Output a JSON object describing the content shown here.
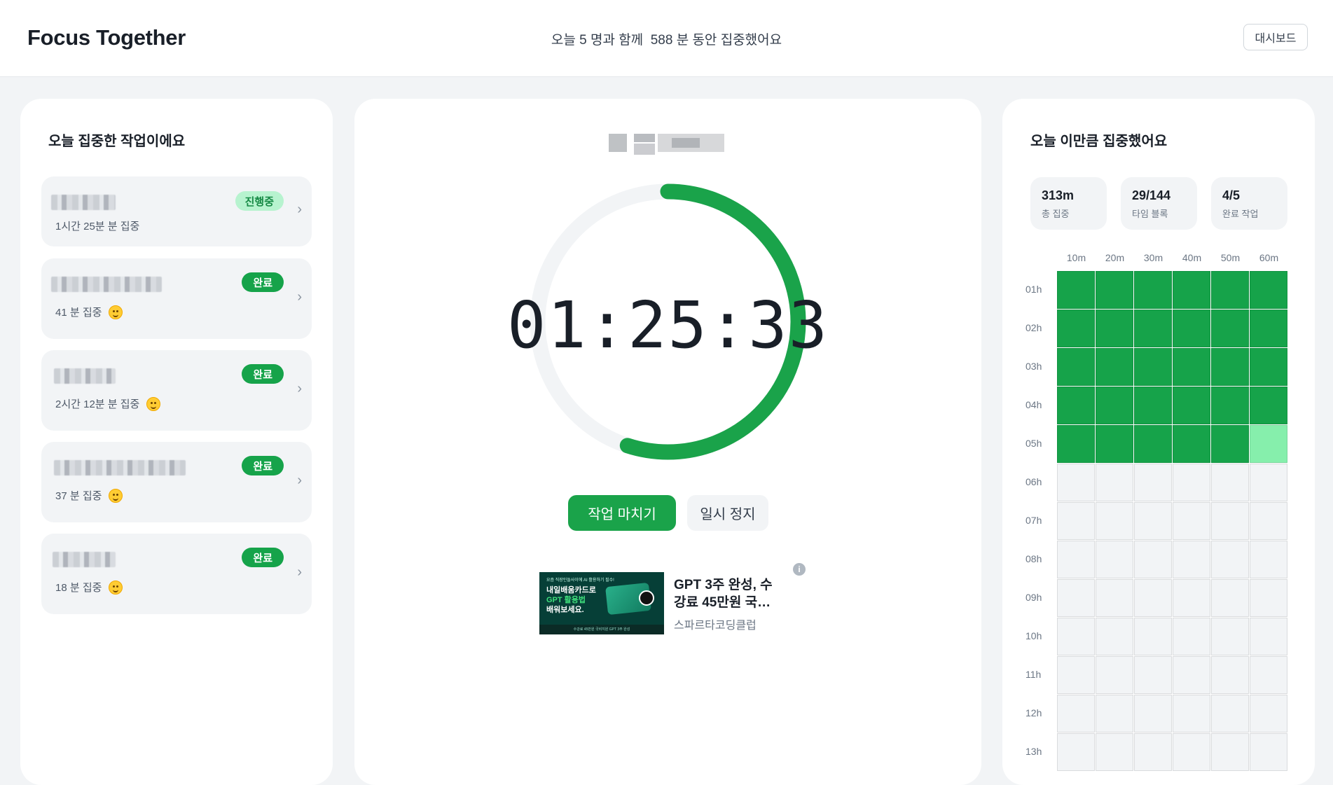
{
  "header": {
    "brand": "Focus Together",
    "summary_parts": [
      "오늘 5 명과 함께  588 분 동안 집중했어요"
    ],
    "dashboard_button": "대시보드"
  },
  "left_panel": {
    "title": "오늘 집중한 작업이에요",
    "tasks": [
      {
        "status": "진행중",
        "status_kind": "progress",
        "duration": "1시간 25분 분 집중",
        "emoji": false
      },
      {
        "status": "완료",
        "status_kind": "done",
        "duration": "41 분 집중",
        "emoji": true
      },
      {
        "status": "완료",
        "status_kind": "done",
        "duration": "2시간 12분 분 집중",
        "emoji": true
      },
      {
        "status": "완료",
        "status_kind": "done",
        "duration": "37 분 집중",
        "emoji": true
      },
      {
        "status": "완료",
        "status_kind": "done",
        "duration": "18 분 집중",
        "emoji": true
      }
    ],
    "chevron_icon": "chevron-right-icon"
  },
  "center_panel": {
    "timer": "01:25:33",
    "progress_fraction": 0.55,
    "colors": {
      "accent": "#1aa34a",
      "track": "#f2f4f6"
    },
    "primary_button": "작업 마치기",
    "secondary_button": "일시 정지",
    "ad": {
      "thumb_small": "요즘 직장인들사이에 AI 활용하기 필수!",
      "thumb_line1": "내일배움카드로",
      "thumb_line2": "GPT 활용법",
      "thumb_line3": "배워보세요.",
      "thumb_bottom": "수강료 45만원 국비지원 GPT 3주 완성",
      "title": "GPT 3주 완성, 수강료 45만원 국…",
      "source": "스파르타코딩클럽",
      "info_icon": "info-icon"
    }
  },
  "right_panel": {
    "title": "오늘 이만큼 집중했어요",
    "stats": [
      {
        "value": "313m",
        "label": "총 집중"
      },
      {
        "value": "29/144",
        "label": "타임 블록"
      },
      {
        "value": "4/5",
        "label": "완료 작업"
      }
    ],
    "grid": {
      "columns": [
        "10m",
        "20m",
        "30m",
        "40m",
        "50m",
        "60m"
      ],
      "rows": [
        "01h",
        "02h",
        "03h",
        "04h",
        "05h",
        "06h",
        "07h",
        "08h",
        "09h",
        "10h",
        "11h",
        "12h",
        "13h"
      ],
      "filled_blocks": 29,
      "partial_block_index": 29,
      "colors": {
        "full": "#16a34a",
        "partial": "#86efac",
        "empty": "#f2f4f6"
      }
    }
  }
}
